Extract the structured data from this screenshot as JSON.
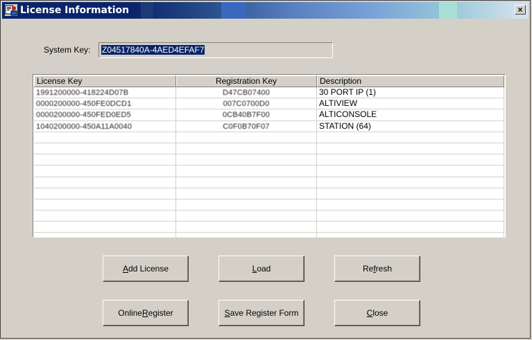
{
  "window": {
    "title": "License Information",
    "close_glyph": "×"
  },
  "system_key": {
    "label": "System Key:",
    "value": "Z04517840A-4AED4EFAF7"
  },
  "table": {
    "columns": [
      "License Key",
      "Registration Key",
      "Description"
    ],
    "rows": [
      {
        "license_key": "1991200000-418224D07B",
        "registration_key": "D47CB07400",
        "description": "30 PORT IP (1)"
      },
      {
        "license_key": "0000200000-450FE0DCD1",
        "registration_key": "007C0700D0",
        "description": "ALTIVIEW"
      },
      {
        "license_key": "0000200000-450FED0ED5",
        "registration_key": "0CB40B7F00",
        "description": "ALTICONSOLE"
      },
      {
        "license_key": "1040200000-450A11A0040",
        "registration_key": "C0F0B70F07",
        "description": "STATION (64)"
      },
      {
        "license_key": "",
        "registration_key": "",
        "description": ""
      },
      {
        "license_key": "",
        "registration_key": "",
        "description": ""
      },
      {
        "license_key": "",
        "registration_key": "",
        "description": ""
      },
      {
        "license_key": "",
        "registration_key": "",
        "description": ""
      },
      {
        "license_key": "",
        "registration_key": "",
        "description": ""
      },
      {
        "license_key": "",
        "registration_key": "",
        "description": ""
      },
      {
        "license_key": "",
        "registration_key": "",
        "description": ""
      },
      {
        "license_key": "",
        "registration_key": "",
        "description": ""
      },
      {
        "license_key": "",
        "registration_key": "",
        "description": ""
      },
      {
        "license_key": "",
        "registration_key": "",
        "description": ""
      }
    ]
  },
  "buttons": {
    "add_license": {
      "pre": "",
      "accel": "A",
      "post": "dd License"
    },
    "load": {
      "pre": "",
      "accel": "L",
      "post": "oad"
    },
    "refresh": {
      "pre": "Re",
      "accel": "f",
      "post": "resh"
    },
    "online_register": {
      "pre": "Online ",
      "accel": "R",
      "post": "egister"
    },
    "save_register_form": {
      "pre": "",
      "accel": "S",
      "post": "ave Register Form"
    },
    "close": {
      "pre": "",
      "accel": "C",
      "post": "lose"
    }
  },
  "icons": {
    "app": "license-app-icon",
    "close": "close-icon"
  }
}
